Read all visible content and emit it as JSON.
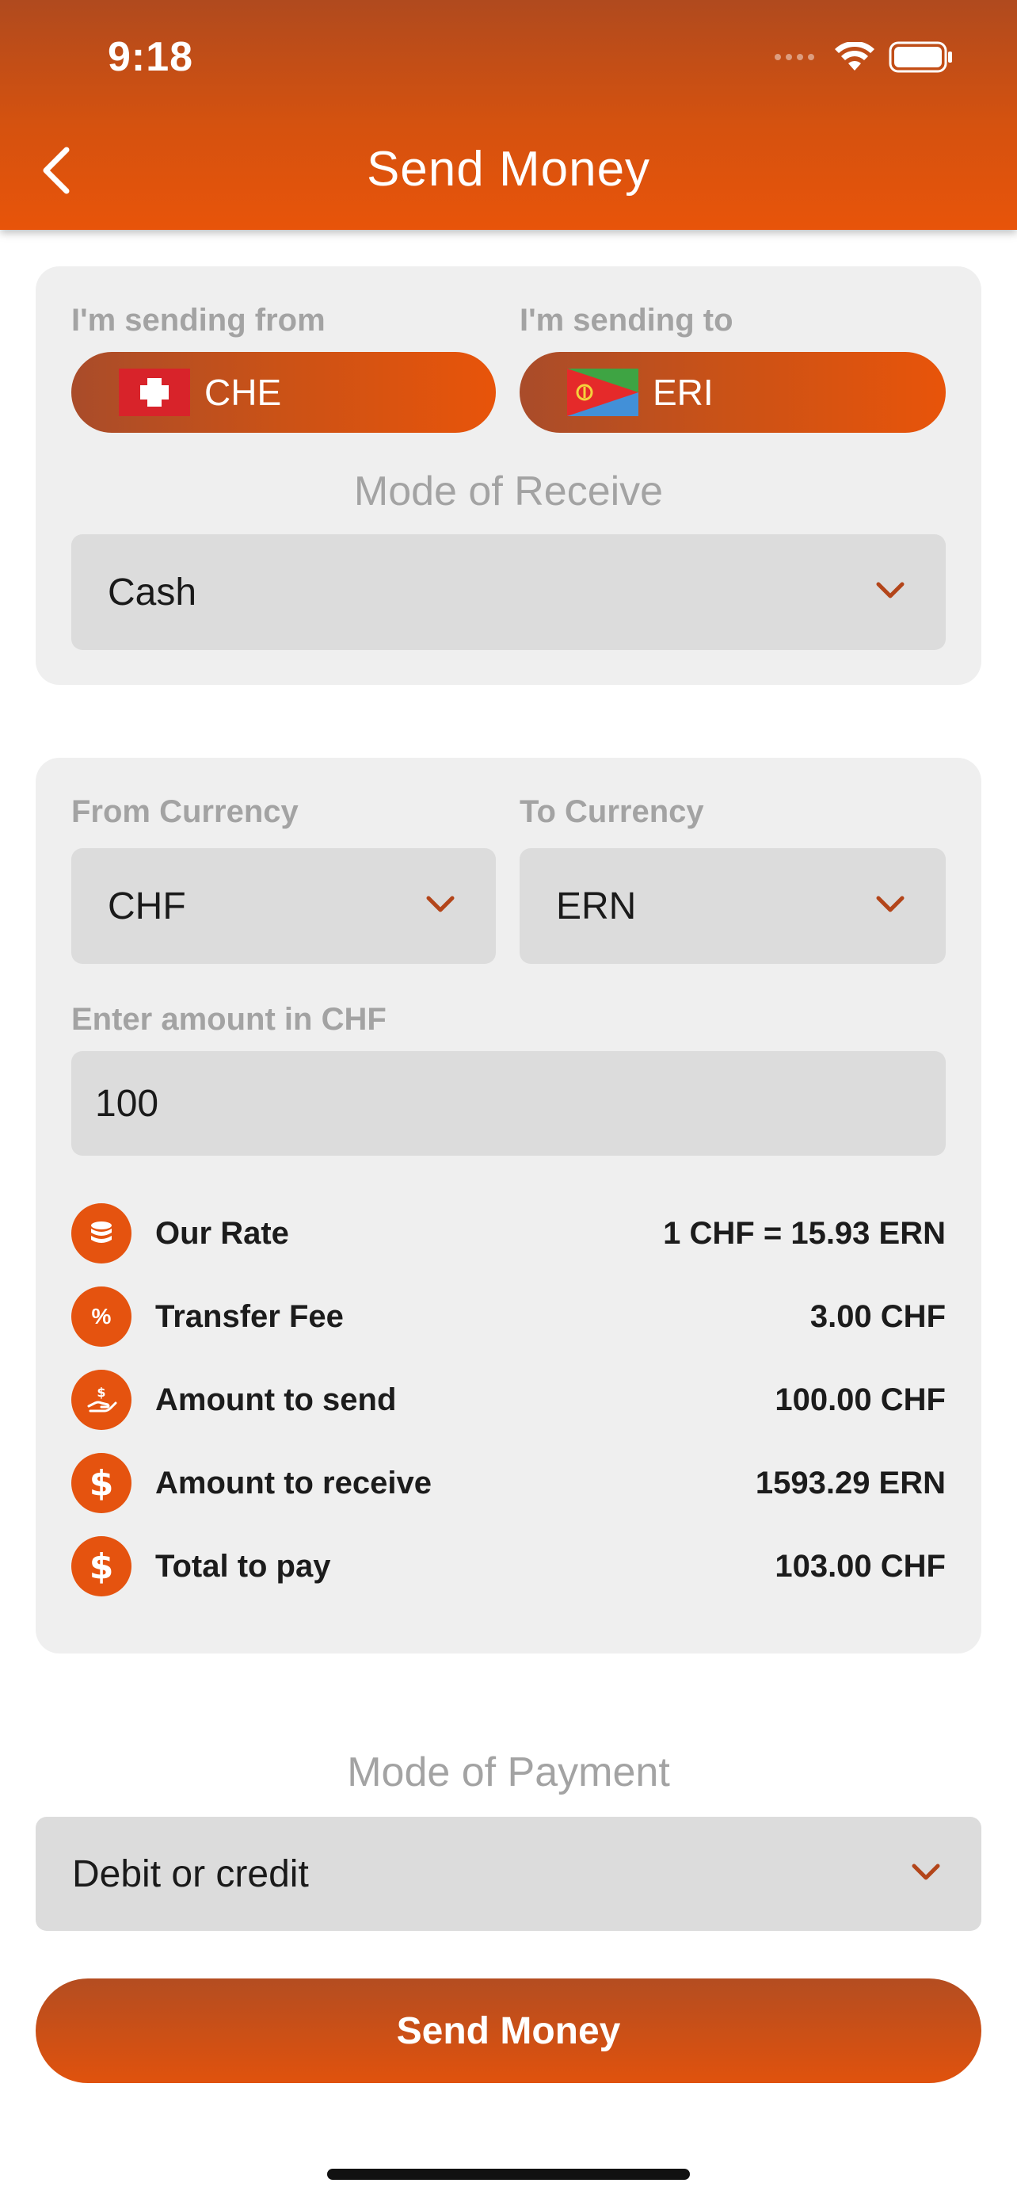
{
  "status_bar": {
    "time": "9:18"
  },
  "header": {
    "title": "Send Money"
  },
  "route": {
    "from_label": "I'm sending from",
    "from_country": "CHE",
    "to_label": "I'm sending to",
    "to_country": "ERI",
    "mode_receive_label": "Mode of Receive",
    "mode_receive_value": "Cash"
  },
  "conversion": {
    "from_currency_label": "From Currency",
    "from_currency": "CHF",
    "to_currency_label": "To Currency",
    "to_currency": "ERN",
    "amount_label": "Enter amount in CHF",
    "amount_value": "100",
    "rows": [
      {
        "label": "Our Rate",
        "value": "1 CHF = 15.93 ERN",
        "icon": "coins-icon"
      },
      {
        "label": "Transfer Fee",
        "value": "3.00 CHF",
        "icon": "percent-icon"
      },
      {
        "label": "Amount to send",
        "value": "100.00 CHF",
        "icon": "hand-money-icon"
      },
      {
        "label": "Amount to receive",
        "value": "1593.29 ERN",
        "icon": "dollar-icon"
      },
      {
        "label": "Total to pay",
        "value": "103.00 CHF",
        "icon": "dollar-icon"
      }
    ]
  },
  "payment": {
    "mode_label": "Mode of Payment",
    "mode_value": "Debit or credit"
  },
  "actions": {
    "send_label": "Send Money"
  },
  "colors": {
    "accent": "#e5530f",
    "accent_dark": "#b04a1e",
    "card_bg": "#efefef",
    "field_bg": "#dcdcdc"
  }
}
